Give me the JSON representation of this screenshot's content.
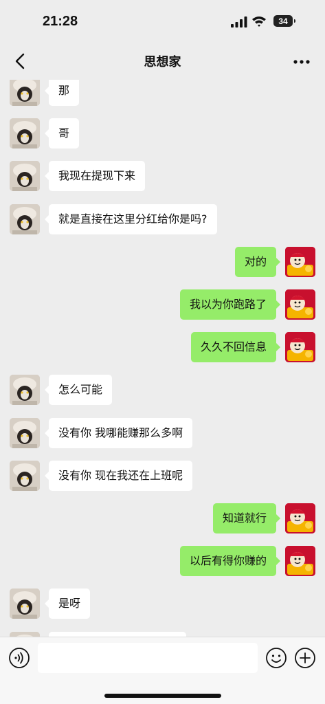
{
  "status_bar": {
    "time": "21:28",
    "battery": "34"
  },
  "header": {
    "title": "思想家",
    "back_icon": "chevron-left-icon",
    "more_icon": "more-dots-icon"
  },
  "messages": [
    {
      "side": "left",
      "text": "那"
    },
    {
      "side": "left",
      "text": "哥"
    },
    {
      "side": "left",
      "text": "我现在提现下来"
    },
    {
      "side": "left",
      "text": "就是直接在这里分红给你是吗?"
    },
    {
      "side": "right",
      "text": "对的"
    },
    {
      "side": "right",
      "text": "我以为你跑路了"
    },
    {
      "side": "right",
      "text": "久久不回信息"
    },
    {
      "side": "left",
      "text": "怎么可能"
    },
    {
      "side": "left",
      "text": "没有你 我哪能赚那么多啊"
    },
    {
      "side": "left",
      "text": "没有你 现在我还在上班呢"
    },
    {
      "side": "right",
      "text": "知道就行"
    },
    {
      "side": "right",
      "text": "以后有得你赚的"
    },
    {
      "side": "left",
      "text": "是呀"
    },
    {
      "side": "left",
      "text": ""
    }
  ],
  "input_bar": {
    "value": "",
    "voice_icon": "voice-icon",
    "emoji_icon": "emoji-icon",
    "plus_icon": "plus-icon"
  },
  "colors": {
    "background": "#ededed",
    "sent_bubble": "#95ec69",
    "received_bubble": "#ffffff"
  }
}
